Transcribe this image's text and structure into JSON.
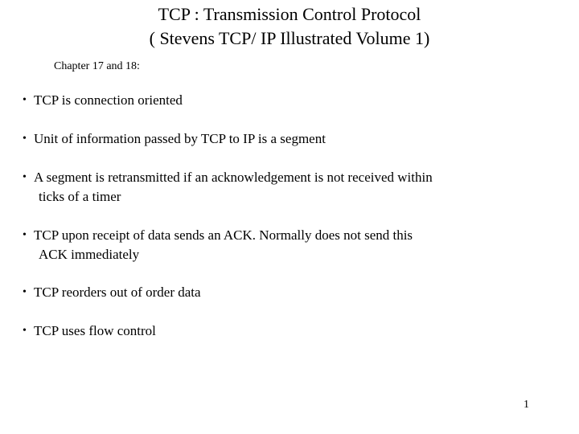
{
  "title": {
    "line1": "TCP : Transmission Control Protocol",
    "line2": "( Stevens TCP/ IP Illustrated Volume 1)"
  },
  "subtitle": "Chapter 17 and 18:",
  "bullets": [
    {
      "line1": "TCP is connection oriented",
      "line2": ""
    },
    {
      "line1": "Unit of information passed by TCP to IP is a segment",
      "line2": ""
    },
    {
      "line1": "A segment is retransmitted if an acknowledgement is not received within",
      "line2": "ticks of a timer"
    },
    {
      "line1": "TCP upon receipt of data sends an ACK. Normally does not send this",
      "line2": "ACK immediately"
    },
    {
      "line1": "TCP reorders out of order data",
      "line2": ""
    },
    {
      "line1": "TCP uses flow control",
      "line2": ""
    }
  ],
  "bullet_glyph": "•",
  "page_number": "1"
}
